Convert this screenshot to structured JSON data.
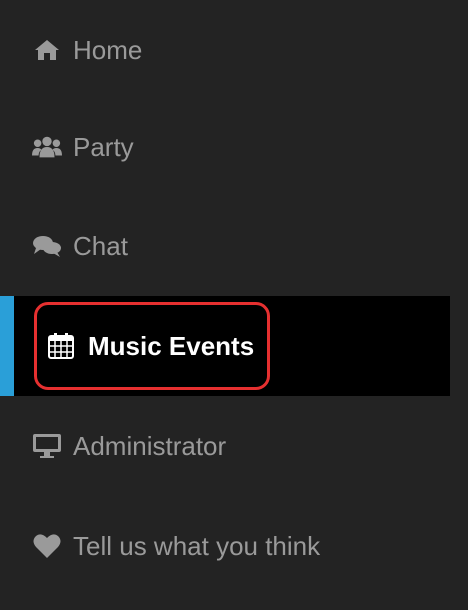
{
  "colors": {
    "background": "#232323",
    "active_background": "#000000",
    "active_indicator": "#2a9fd8",
    "highlight_border": "#e63030",
    "text": "#9a9a9a",
    "active_text": "#ffffff"
  },
  "nav": {
    "items": [
      {
        "label": "Home",
        "icon": "home-icon"
      },
      {
        "label": "Party",
        "icon": "users-icon"
      },
      {
        "label": "Chat",
        "icon": "chat-icon"
      },
      {
        "label": "Music Events",
        "icon": "calendar-icon",
        "active": true
      },
      {
        "label": "Administrator",
        "icon": "monitor-icon"
      },
      {
        "label": "Tell us what you think",
        "icon": "heart-icon"
      }
    ]
  }
}
